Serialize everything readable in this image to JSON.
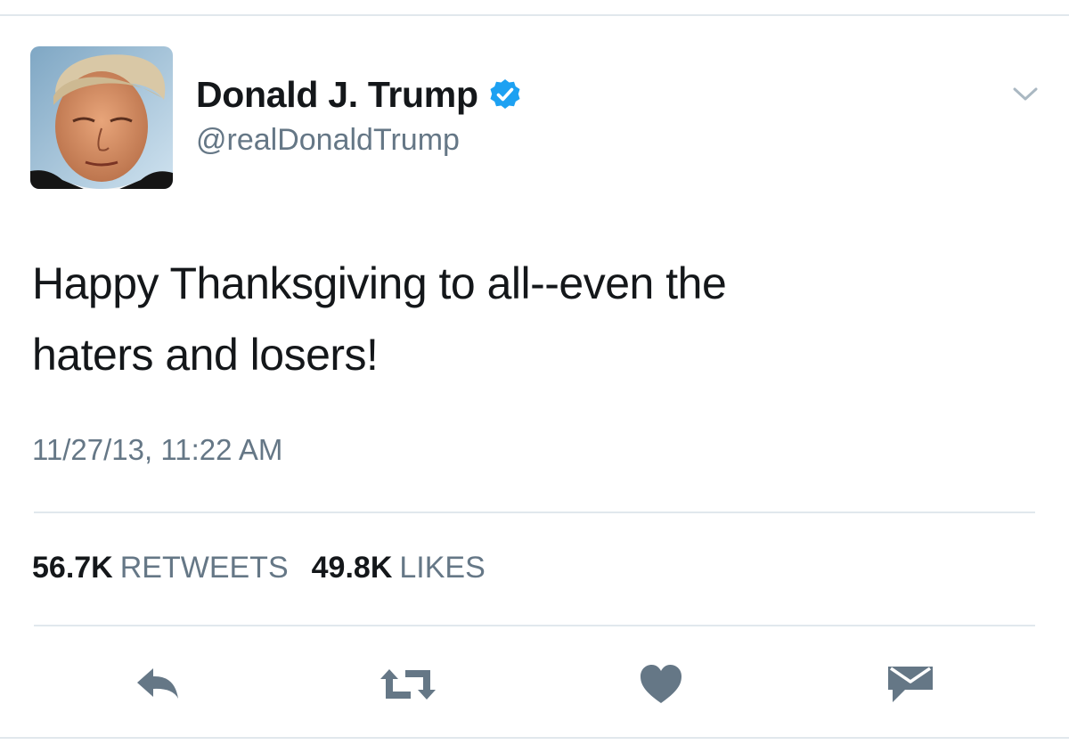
{
  "tweet": {
    "author": {
      "name": "Donald J. Trump",
      "handle": "@realDonaldTrump",
      "verified": true,
      "avatar_icon": "profile-photo"
    },
    "text_lines": [
      "Happy Thanksgiving to all--even the",
      "haters and losers!"
    ],
    "timestamp": "11/27/13, 11:22 AM",
    "stats": {
      "retweets_count": "56.7K",
      "retweets_label": "RETWEETS",
      "likes_count": "49.8K",
      "likes_label": "LIKES"
    },
    "actions": [
      "reply-icon",
      "retweet-icon",
      "like-icon",
      "direct-message-icon"
    ]
  },
  "colors": {
    "text_primary": "#14171a",
    "text_secondary": "#657786",
    "verified_blue": "#1da1f2",
    "icon_gray": "#657786",
    "border": "#e1e8ed"
  }
}
